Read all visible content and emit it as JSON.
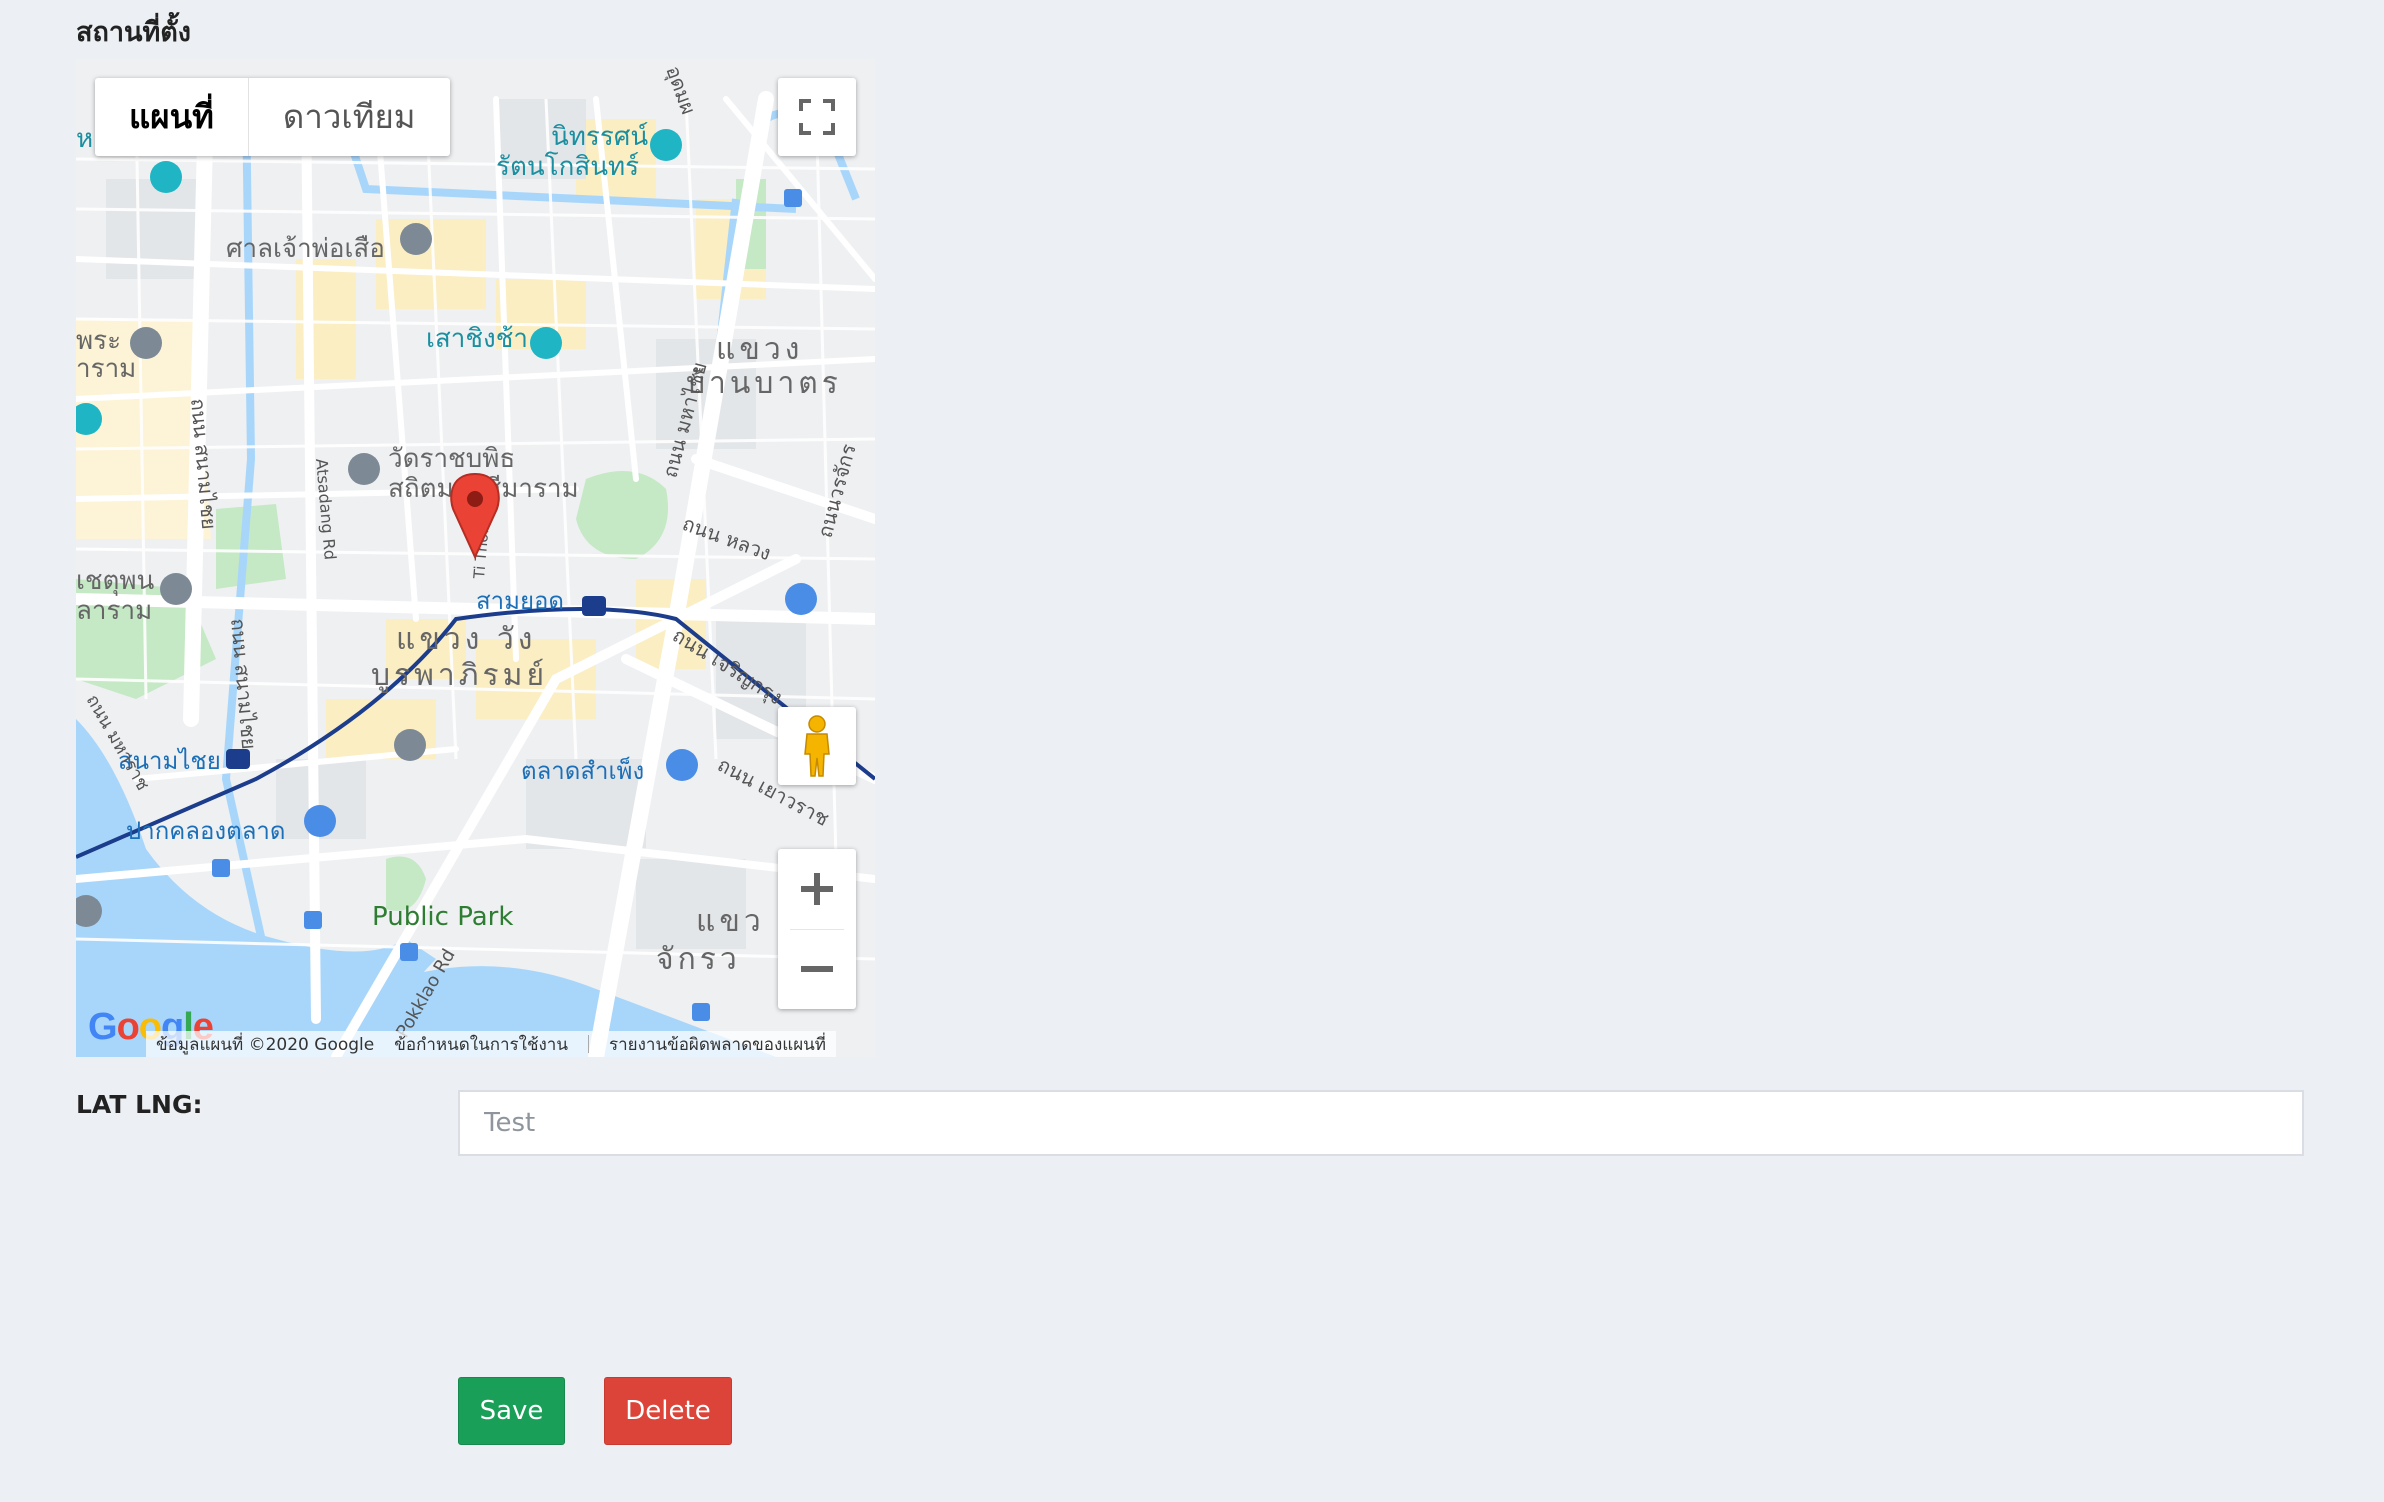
{
  "form": {
    "location_label": "สถานที่ตั้ง",
    "latlng_label": "LAT LNG:",
    "latlng_placeholder": "Test",
    "save_label": "Save",
    "delete_label": "Delete"
  },
  "map": {
    "type_map_label": "แผนที่",
    "type_satellite_label": "ดาวเทียม",
    "attribution_data": "ข้อมูลแผนที่ ©2020 Google",
    "attribution_terms": "ข้อกำหนดในการใช้งาน",
    "attribution_report": "รายงานข้อผิดพลาดของแผนที่",
    "google_logo": "Google",
    "places": {
      "museum": "นิทรรศน์",
      "museum2": "รัตนโกสินทร์",
      "shrine": "ศาลเจ้าพ่อเสือ",
      "giant_swing": "เสาชิงช้า",
      "temple": "วัดราชบพิธ",
      "temple2": "สถิตมหาสีมาราม",
      "district_ne1": "แขวง",
      "district_ne2": "บ้านบาตร",
      "district_center1": "แขวง วัง",
      "district_center2": "บูรพาภิรมย์",
      "station_sam_yot": "สามยอด",
      "station_sanam_chai": "สนามไชย",
      "market_sampeng": "ตลาดสำเพ็ง",
      "flower_market": "ปากคลองตลาด",
      "park": "Public Park",
      "district_se1": "แขว",
      "district_se2": "จักรว",
      "left_label1": "หลวง",
      "left_label2": "พระ",
      "left_label3": "าราม",
      "left_label4": "เชตุพน",
      "left_label5": "ลาราม",
      "road1": "ถนน มหาไชย",
      "road2": "ถนน หลวง",
      "road3": "ถนน เจริญกรุง",
      "road4": "ถนน เยาวราช",
      "road5": "ถนนวรจักร",
      "road6": "ถนน สนามไชย",
      "road7": "Atsadang Rd",
      "road8": "Pokklao Rd",
      "road9": "Ti Thong Rd",
      "road10": "ถนน สนามไชย",
      "road11": "ถนน มหาราช",
      "top_label": "อุดมผ"
    }
  },
  "colors": {
    "save": "#1a9f58",
    "delete": "#dd4439",
    "background": "#eceff3",
    "marker": "#ea4335",
    "water": "#a8d6fb",
    "park": "#c5e8c5"
  }
}
